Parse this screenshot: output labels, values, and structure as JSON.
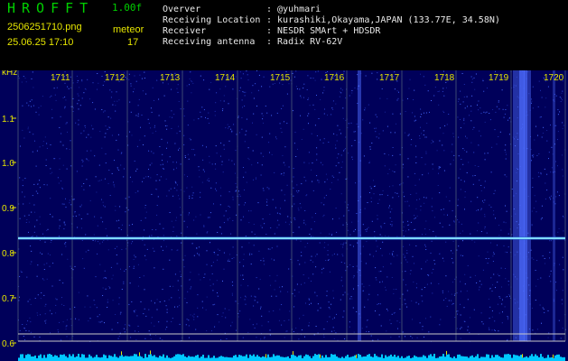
{
  "header": {
    "logo": "HROFFT",
    "version": "1.00f",
    "file_name": "2506251710.png",
    "mode": "meteor",
    "datetime": "25.06.25 17:10",
    "count": "17",
    "info_rows": [
      {
        "label": "Overver",
        "value": ": @yuhmari"
      },
      {
        "label": "Receiving Location",
        "value": ": kurashiki,Okayama,JAPAN (133.77E, 34.58N)"
      },
      {
        "label": "Receiver",
        "value": ": NESDR SMArt + HDSDR"
      },
      {
        "label": "Receiving antenna",
        "value": ": Radix RV-62V"
      }
    ]
  },
  "waterfall": {
    "unit_label": "kHz",
    "minute_labels": [
      "1711",
      "1712",
      "1713",
      "1714",
      "1715",
      "1716",
      "1717",
      "1718",
      "1719",
      "1720"
    ],
    "freq_labels": [
      "1.1",
      "1.0",
      "0.9",
      "0.8",
      "0.7",
      "0.6"
    ],
    "colors": {
      "background": "#00005a",
      "grid": "#4b5c78",
      "labels": "#e6e600",
      "signal": "#7fd9ff",
      "spectrum": "#00c8ff"
    }
  }
}
